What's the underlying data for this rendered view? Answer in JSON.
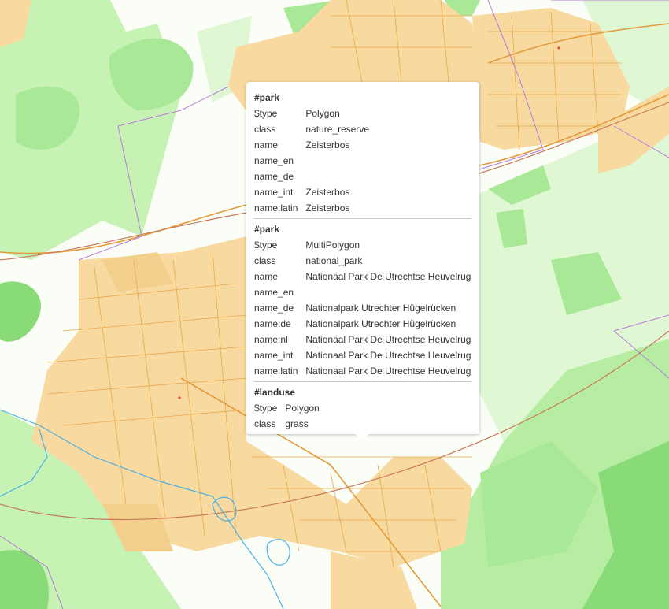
{
  "map": {
    "colors": {
      "background": "#fbfdf7",
      "urban": "#f8d9a0",
      "urban_dark": "#f3cf8c",
      "grass": "#c6f2b4",
      "grass_light": "#dff7d2",
      "forest": "#a8e896",
      "forest_dark": "#88db76",
      "road": "#e9a94a",
      "boundary": "#b77ddc",
      "water": "#4ab0e6",
      "rail": "#c87a5a"
    }
  },
  "popup": {
    "features": [
      {
        "title": "#park",
        "properties": [
          {
            "key": "$type",
            "value": "Polygon"
          },
          {
            "key": "class",
            "value": "nature_reserve"
          },
          {
            "key": "name",
            "value": "Zeisterbos"
          },
          {
            "key": "name_en",
            "value": ""
          },
          {
            "key": "name_de",
            "value": ""
          },
          {
            "key": "name_int",
            "value": "Zeisterbos"
          },
          {
            "key": "name:latin",
            "value": "Zeisterbos"
          }
        ]
      },
      {
        "title": "#park",
        "properties": [
          {
            "key": "$type",
            "value": "MultiPolygon"
          },
          {
            "key": "class",
            "value": "national_park"
          },
          {
            "key": "name",
            "value": "Nationaal Park De Utrechtse Heuvelrug"
          },
          {
            "key": "name_en",
            "value": ""
          },
          {
            "key": "name_de",
            "value": "Nationalpark Utrechter Hügelrücken"
          },
          {
            "key": "name:de",
            "value": "Nationalpark Utrechter Hügelrücken"
          },
          {
            "key": "name:nl",
            "value": "Nationaal Park De Utrechtse Heuvelrug"
          },
          {
            "key": "name_int",
            "value": "Nationaal Park De Utrechtse Heuvelrug"
          },
          {
            "key": "name:latin",
            "value": "Nationaal Park De Utrechtse Heuvelrug"
          }
        ]
      },
      {
        "title": "#landuse",
        "properties": [
          {
            "key": "$type",
            "value": "Polygon"
          },
          {
            "key": "class",
            "value": "grass"
          }
        ]
      }
    ]
  }
}
